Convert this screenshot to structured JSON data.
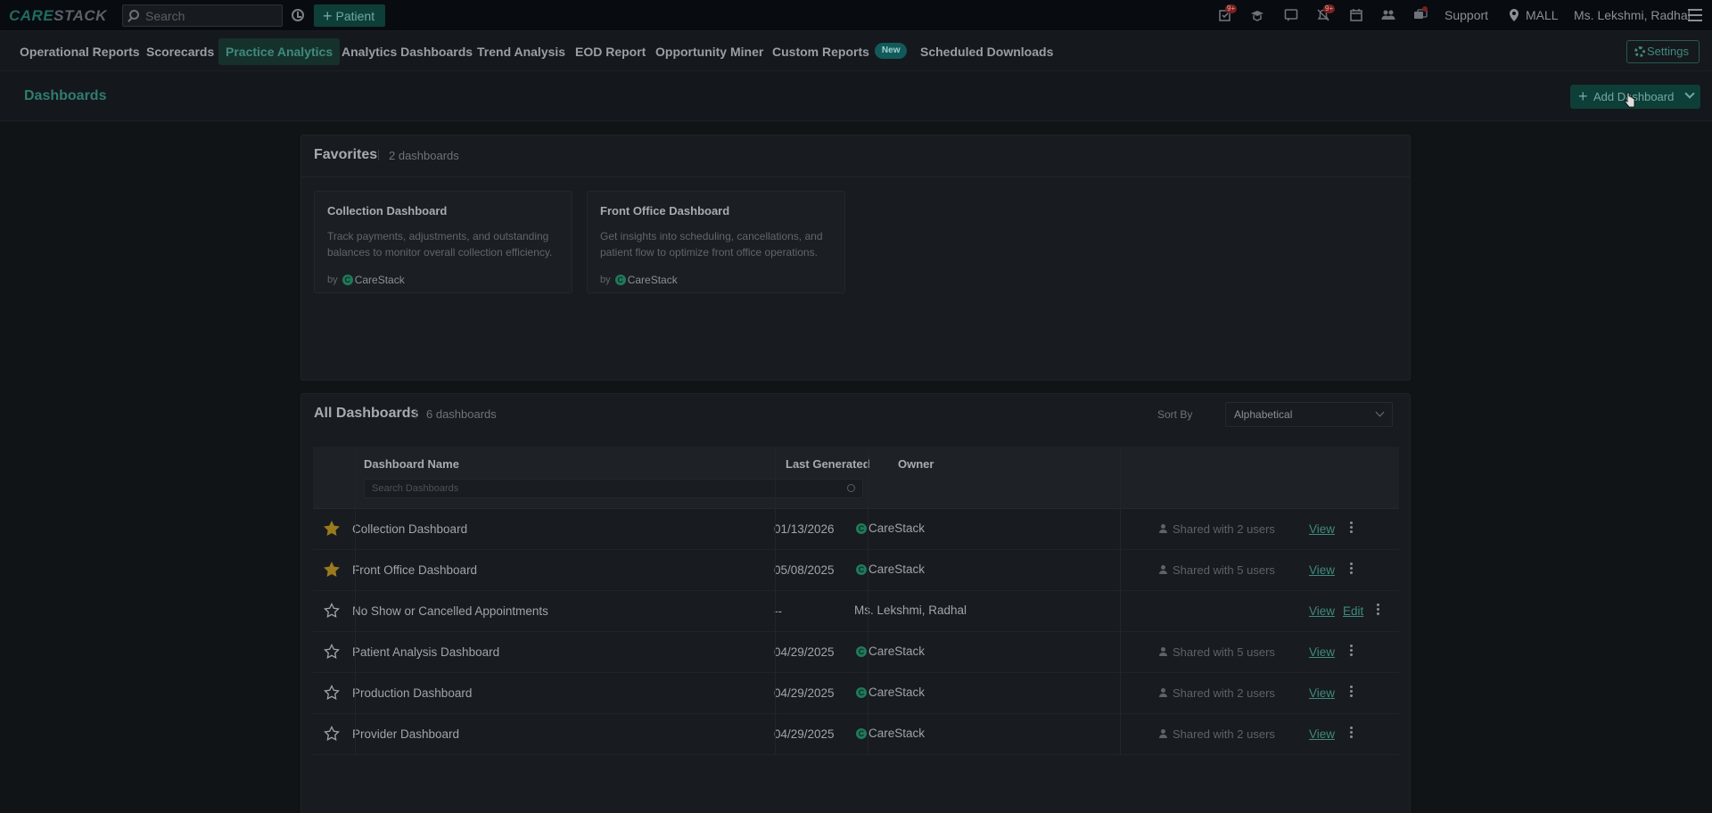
{
  "topbar": {
    "logo_care": "CARE",
    "logo_stack": "STACK",
    "search_placeholder": "Search",
    "patient_button": "Patient",
    "badges": {
      "tasks": "9+",
      "alerts": "9+"
    },
    "support": "Support",
    "location": "MALL",
    "user": "Ms. Lekshmi, Radhal"
  },
  "nav": {
    "items": [
      "Operational Reports",
      "Scorecards",
      "Practice Analytics",
      "Analytics Dashboards",
      "Trend Analysis",
      "EOD Report",
      "Opportunity Miner",
      "Custom Reports",
      "Scheduled Downloads"
    ],
    "active": "Practice Analytics",
    "new_badge": "New",
    "settings": "Settings"
  },
  "subheader": {
    "title": "Dashboards",
    "add_button": "Add Dashboard"
  },
  "favorites": {
    "title": "Favorites",
    "count": "2 dashboards",
    "cards": [
      {
        "title": "Collection Dashboard",
        "description": "Track payments, adjustments, and outstanding balances to monitor overall collection efficiency.",
        "by": "by",
        "author": "CareStack"
      },
      {
        "title": "Front Office Dashboard",
        "description": "Get insights into scheduling, cancellations, and patient flow to optimize front office operations.",
        "by": "by",
        "author": "CareStack"
      }
    ]
  },
  "all_dashboards": {
    "title": "All Dashboards",
    "count": "6 dashboards",
    "sort_label": "Sort By",
    "sort_value": "Alphabetical",
    "columns": {
      "name": "Dashboard Name",
      "last_generated": "Last Generated",
      "owner": "Owner"
    },
    "search_placeholder": "Search Dashboards",
    "rows": [
      {
        "name": "Collection Dashboard",
        "date": "01/13/2026",
        "owner": "CareStack",
        "shared": "Shared with 2 users",
        "view": "View",
        "favorite": true
      },
      {
        "name": "Front Office Dashboard",
        "date": "05/08/2025",
        "owner": "CareStack",
        "shared": "Shared with 5 users",
        "view": "View",
        "favorite": true
      },
      {
        "name": "No Show or Cancelled Appointments",
        "date": "--",
        "owner": "Ms. Lekshmi, Radhal",
        "shared": "",
        "view": "View",
        "edit": "Edit",
        "favorite": false
      },
      {
        "name": "Patient Analysis Dashboard",
        "date": "04/29/2025",
        "owner": "CareStack",
        "shared": "Shared with 5 users",
        "view": "View",
        "favorite": false
      },
      {
        "name": "Production Dashboard",
        "date": "04/29/2025",
        "owner": "CareStack",
        "shared": "Shared with 2 users",
        "view": "View",
        "favorite": false
      },
      {
        "name": "Provider Dashboard",
        "date": "04/29/2025",
        "owner": "CareStack",
        "shared": "Shared with 2 users",
        "view": "View",
        "favorite": false
      }
    ]
  },
  "colors": {
    "accent": "#3f8a7d",
    "star_active": "#9a7a1e",
    "background": "#111417"
  }
}
